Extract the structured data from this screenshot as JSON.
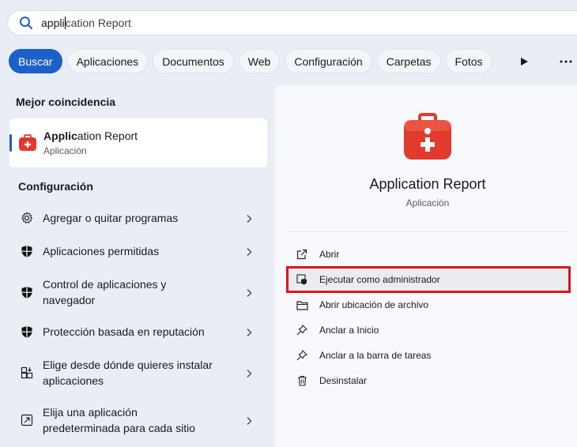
{
  "search": {
    "typed": "appli",
    "rest": "cation Report"
  },
  "filters": [
    {
      "label": "Buscar",
      "active": true
    },
    {
      "label": "Aplicaciones"
    },
    {
      "label": "Documentos"
    },
    {
      "label": "Web"
    },
    {
      "label": "Configuración"
    },
    {
      "label": "Carpetas"
    },
    {
      "label": "Fotos"
    }
  ],
  "left": {
    "best_match_title": "Mejor coincidencia",
    "best_match": {
      "name_bold": "Applic",
      "name_rest": "ation Report",
      "type": "Aplicación"
    },
    "settings_title": "Configuración",
    "settings": [
      {
        "label": "Agregar o quitar programas",
        "icon": "gear-icon"
      },
      {
        "label": "Aplicaciones permitidas",
        "icon": "shield-icon"
      },
      {
        "label": "Control de aplicaciones y navegador",
        "icon": "shield-icon"
      },
      {
        "label": "Protección basada en reputación",
        "icon": "shield-icon"
      },
      {
        "label": "Elige desde dónde quieres instalar aplicaciones",
        "icon": "app-install-icon"
      },
      {
        "label": "Elija una aplicación predeterminada para cada sitio",
        "icon": "default-app-icon"
      }
    ]
  },
  "detail": {
    "app_name": "Application Report",
    "app_type": "Aplicación",
    "actions": [
      {
        "label": "Abrir",
        "icon": "open-external-icon"
      },
      {
        "label": "Ejecutar como administrador",
        "icon": "admin-shield-icon"
      },
      {
        "label": "Abrir ubicación de archivo",
        "icon": "folder-icon"
      },
      {
        "label": "Anclar a Inicio",
        "icon": "pin-icon"
      },
      {
        "label": "Anclar a la barra de tareas",
        "icon": "pin-icon"
      },
      {
        "label": "Desinstalar",
        "icon": "trash-icon"
      }
    ]
  },
  "colors": {
    "accent": "#1b61c9",
    "highlight_box": "#e0141e",
    "app_icon": "#e23b2e"
  }
}
